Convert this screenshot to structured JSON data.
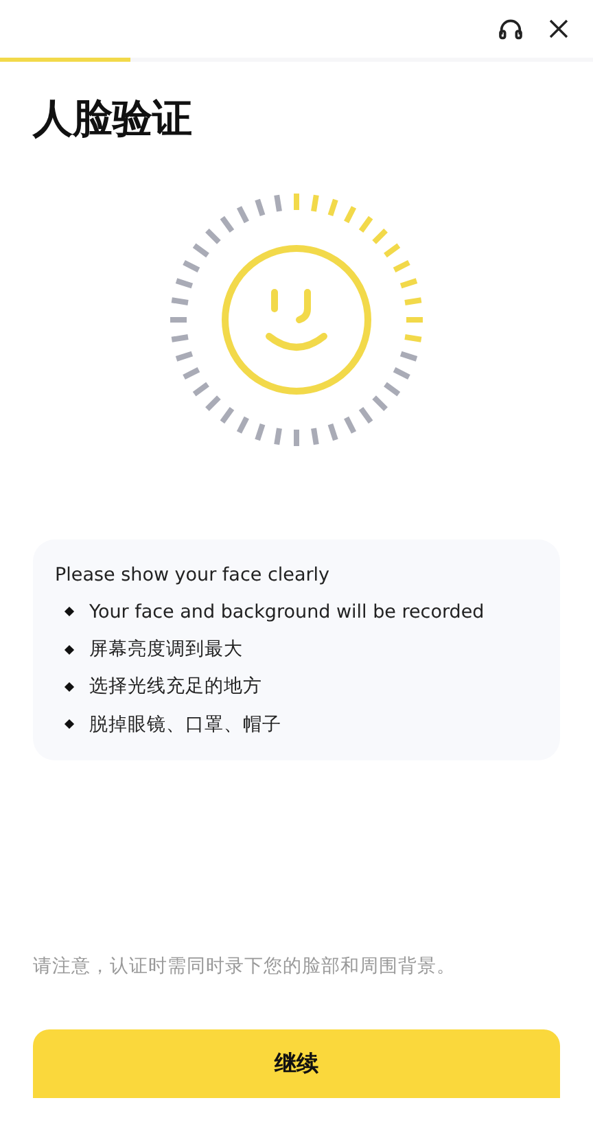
{
  "header": {
    "progress": {
      "level": 0.22
    }
  },
  "title": "人脸验证",
  "scanner": {
    "level": 0.3
  },
  "tips": {
    "heading": "Please show your face clearly",
    "items": [
      "Your face and background will be recorded",
      "屏幕亮度调到最大",
      "选择光线充足的地方",
      "脱掉眼镜、口罩、帽子"
    ]
  },
  "note": "请注意，认证时需同时录下您的脸部和周围背景。",
  "button": "继续"
}
